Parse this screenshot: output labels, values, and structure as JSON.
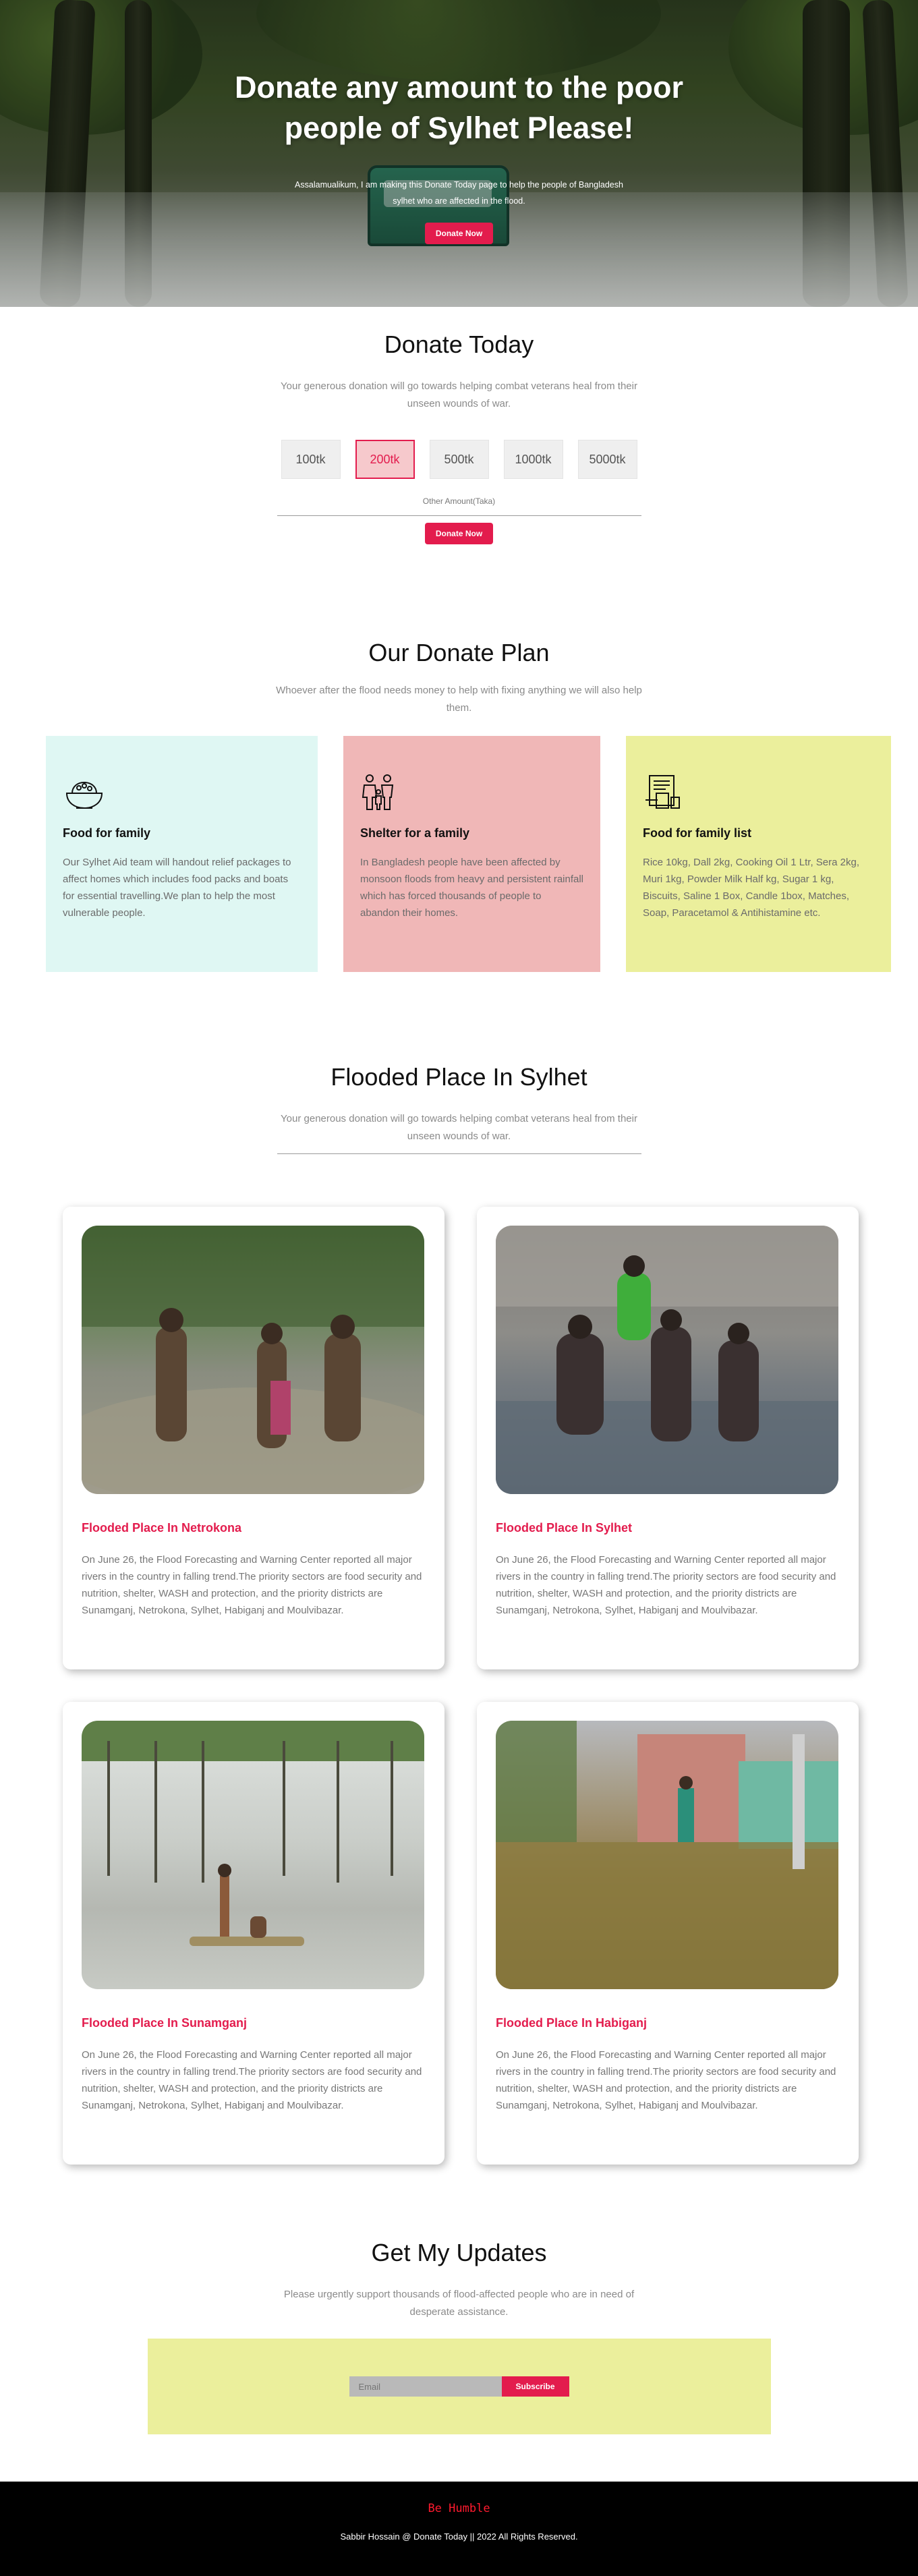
{
  "hero": {
    "title": "Donate any amount to the poor people of Sylhet Please!",
    "text": "Assalamualikum, I am making this Donate Today page to help the people of Bangladesh sylhet who are affected in the flood.",
    "button": "Donate Now"
  },
  "donate": {
    "title": "Donate Today",
    "subtitle": "Your generous donation will go towards helping combat veterans heal from their unseen wounds of war.",
    "amounts": [
      "100tk",
      "200tk",
      "500tk",
      "1000tk",
      "5000tk"
    ],
    "selected": "200tk",
    "other_label": "Other Amount(Taka)",
    "button": "Donate Now"
  },
  "plan": {
    "title": "Our Donate Plan",
    "subtitle": "Whoever after the flood needs money to help with fixing anything we will also help them.",
    "cards": [
      {
        "title": "Food for family",
        "text": "Our Sylhet Aid team will handout relief packages to affect homes which includes food packs and boats for essential travelling.We plan to help the most vulnerable people.",
        "bg": "#dff7f3",
        "icon": "food-bowl-icon"
      },
      {
        "title": "Shelter for a family",
        "text": "In Bangladesh people have been affected by monsoon floods from heavy and persistent rainfall which has forced thousands of people to abandon their homes.",
        "bg": "#f0b7b7",
        "icon": "family-icon"
      },
      {
        "title": "Food for family list",
        "text": "Rice 10kg, Dall 2kg, Cooking Oil 1 Ltr, Sera 2kg, Muri 1kg, Powder Milk Half kg, Sugar 1 kg, Biscuits, Saline 1 Box, Candle 1box, Matches, Soap, Paracetamol & Antihistamine etc.",
        "bg": "#ebef9c",
        "icon": "grocery-list-icon"
      }
    ]
  },
  "flooded": {
    "title": "Flooded Place In Sylhet",
    "subtitle": "Your generous donation will go towards helping combat veterans heal from their unseen wounds of war.",
    "places": [
      {
        "title": "Flooded Place In Netrokona",
        "text": "On June 26, the Flood Forecasting and Warning Center reported all major rivers in the country in falling trend.The priority sectors are food security and nutrition, shelter, WASH and protection, and the priority districts are Sunamganj, Netrokona, Sylhet, Habiganj and Moulvibazar."
      },
      {
        "title": "Flooded Place In Sylhet",
        "text": "On June 26, the Flood Forecasting and Warning Center reported all major rivers in the country in falling trend.The priority sectors are food security and nutrition, shelter, WASH and protection, and the priority districts are Sunamganj, Netrokona, Sylhet, Habiganj and Moulvibazar."
      },
      {
        "title": "Flooded Place In Sunamganj",
        "text": "On June 26, the Flood Forecasting and Warning Center reported all major rivers in the country in falling trend.The priority sectors are food security and nutrition, shelter, WASH and protection, and the priority districts are Sunamganj, Netrokona, Sylhet, Habiganj and Moulvibazar."
      },
      {
        "title": "Flooded Place In Habiganj",
        "text": "On June 26, the Flood Forecasting and Warning Center reported all major rivers in the country in falling trend.The priority sectors are food security and nutrition, shelter, WASH and protection, and the priority districts are Sunamganj, Netrokona, Sylhet, Habiganj and Moulvibazar."
      }
    ]
  },
  "updates": {
    "title": "Get My Updates",
    "subtitle": "Please urgently support thousands of flood-affected people who are in need of desperate assistance.",
    "placeholder": "Email",
    "button": "Subscribe"
  },
  "footer": {
    "brand": "Be Humble",
    "copyright": "Sabbir Hossain @ Donate Today || 2022 All Rights Reserved."
  },
  "colors": {
    "accent": "#e31c4d",
    "footer_bg": "#000000"
  }
}
